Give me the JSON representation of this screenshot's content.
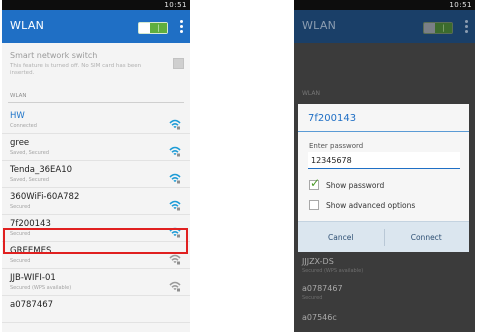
{
  "left_screen": {
    "status_bar": {
      "time": "10:51"
    },
    "app_bar": {
      "title": "WLAN"
    },
    "smart_switch": {
      "title": "Smart network switch",
      "description": "This feature is turned off. No SIM card has been inserted."
    },
    "section_label": "WLAN",
    "networks": [
      {
        "name": "HW",
        "status": "Connected",
        "signal_icon": "wifi-signal-icon"
      },
      {
        "name": "gree",
        "status": "Saved, Secured",
        "signal_icon": "wifi-signal-icon"
      },
      {
        "name": "Tenda_36EA10",
        "status": "Saved, Secured",
        "signal_icon": "wifi-signal-icon"
      },
      {
        "name": "360WiFi-60A782",
        "status": "Secured",
        "signal_icon": "wifi-signal-icon"
      },
      {
        "name": "7f200143",
        "status": "Secured",
        "signal_icon": "wifi-signal-icon"
      },
      {
        "name": "GREEMES",
        "status": "Secured",
        "signal_icon": "wifi-signal-icon"
      },
      {
        "name": "JJB-WIFI-01",
        "status": "Secured (WPS available)",
        "signal_icon": "wifi-signal-icon"
      },
      {
        "name": "a0787467",
        "status": "",
        "signal_icon": ""
      }
    ],
    "highlighted_network": "7f200143"
  },
  "right_screen": {
    "status_bar": {
      "time": "10:51"
    },
    "app_bar": {
      "title": "WLAN"
    },
    "background_section_label": "WLAN",
    "background_networks": [
      {
        "name": "JJJZX-DS",
        "status": "Secured (WPS available)"
      },
      {
        "name": "a0787467",
        "status": "Secured"
      },
      {
        "name": "a07546c",
        "status": ""
      }
    ],
    "dialog": {
      "title": "7f200143",
      "password_label": "Enter password",
      "password_value": "12345678",
      "show_password_label": "Show password",
      "show_password_checked": true,
      "advanced_options_label": "Show advanced options",
      "advanced_options_checked": false,
      "cancel_label": "Cancel",
      "connect_label": "Connect"
    }
  },
  "colors": {
    "accent_blue": "#1f6fc5",
    "connected_blue": "#1e74c9",
    "highlight_red": "#e02020",
    "toggle_green": "#5fae3f",
    "wifi_teal": "#1c9bd6"
  }
}
